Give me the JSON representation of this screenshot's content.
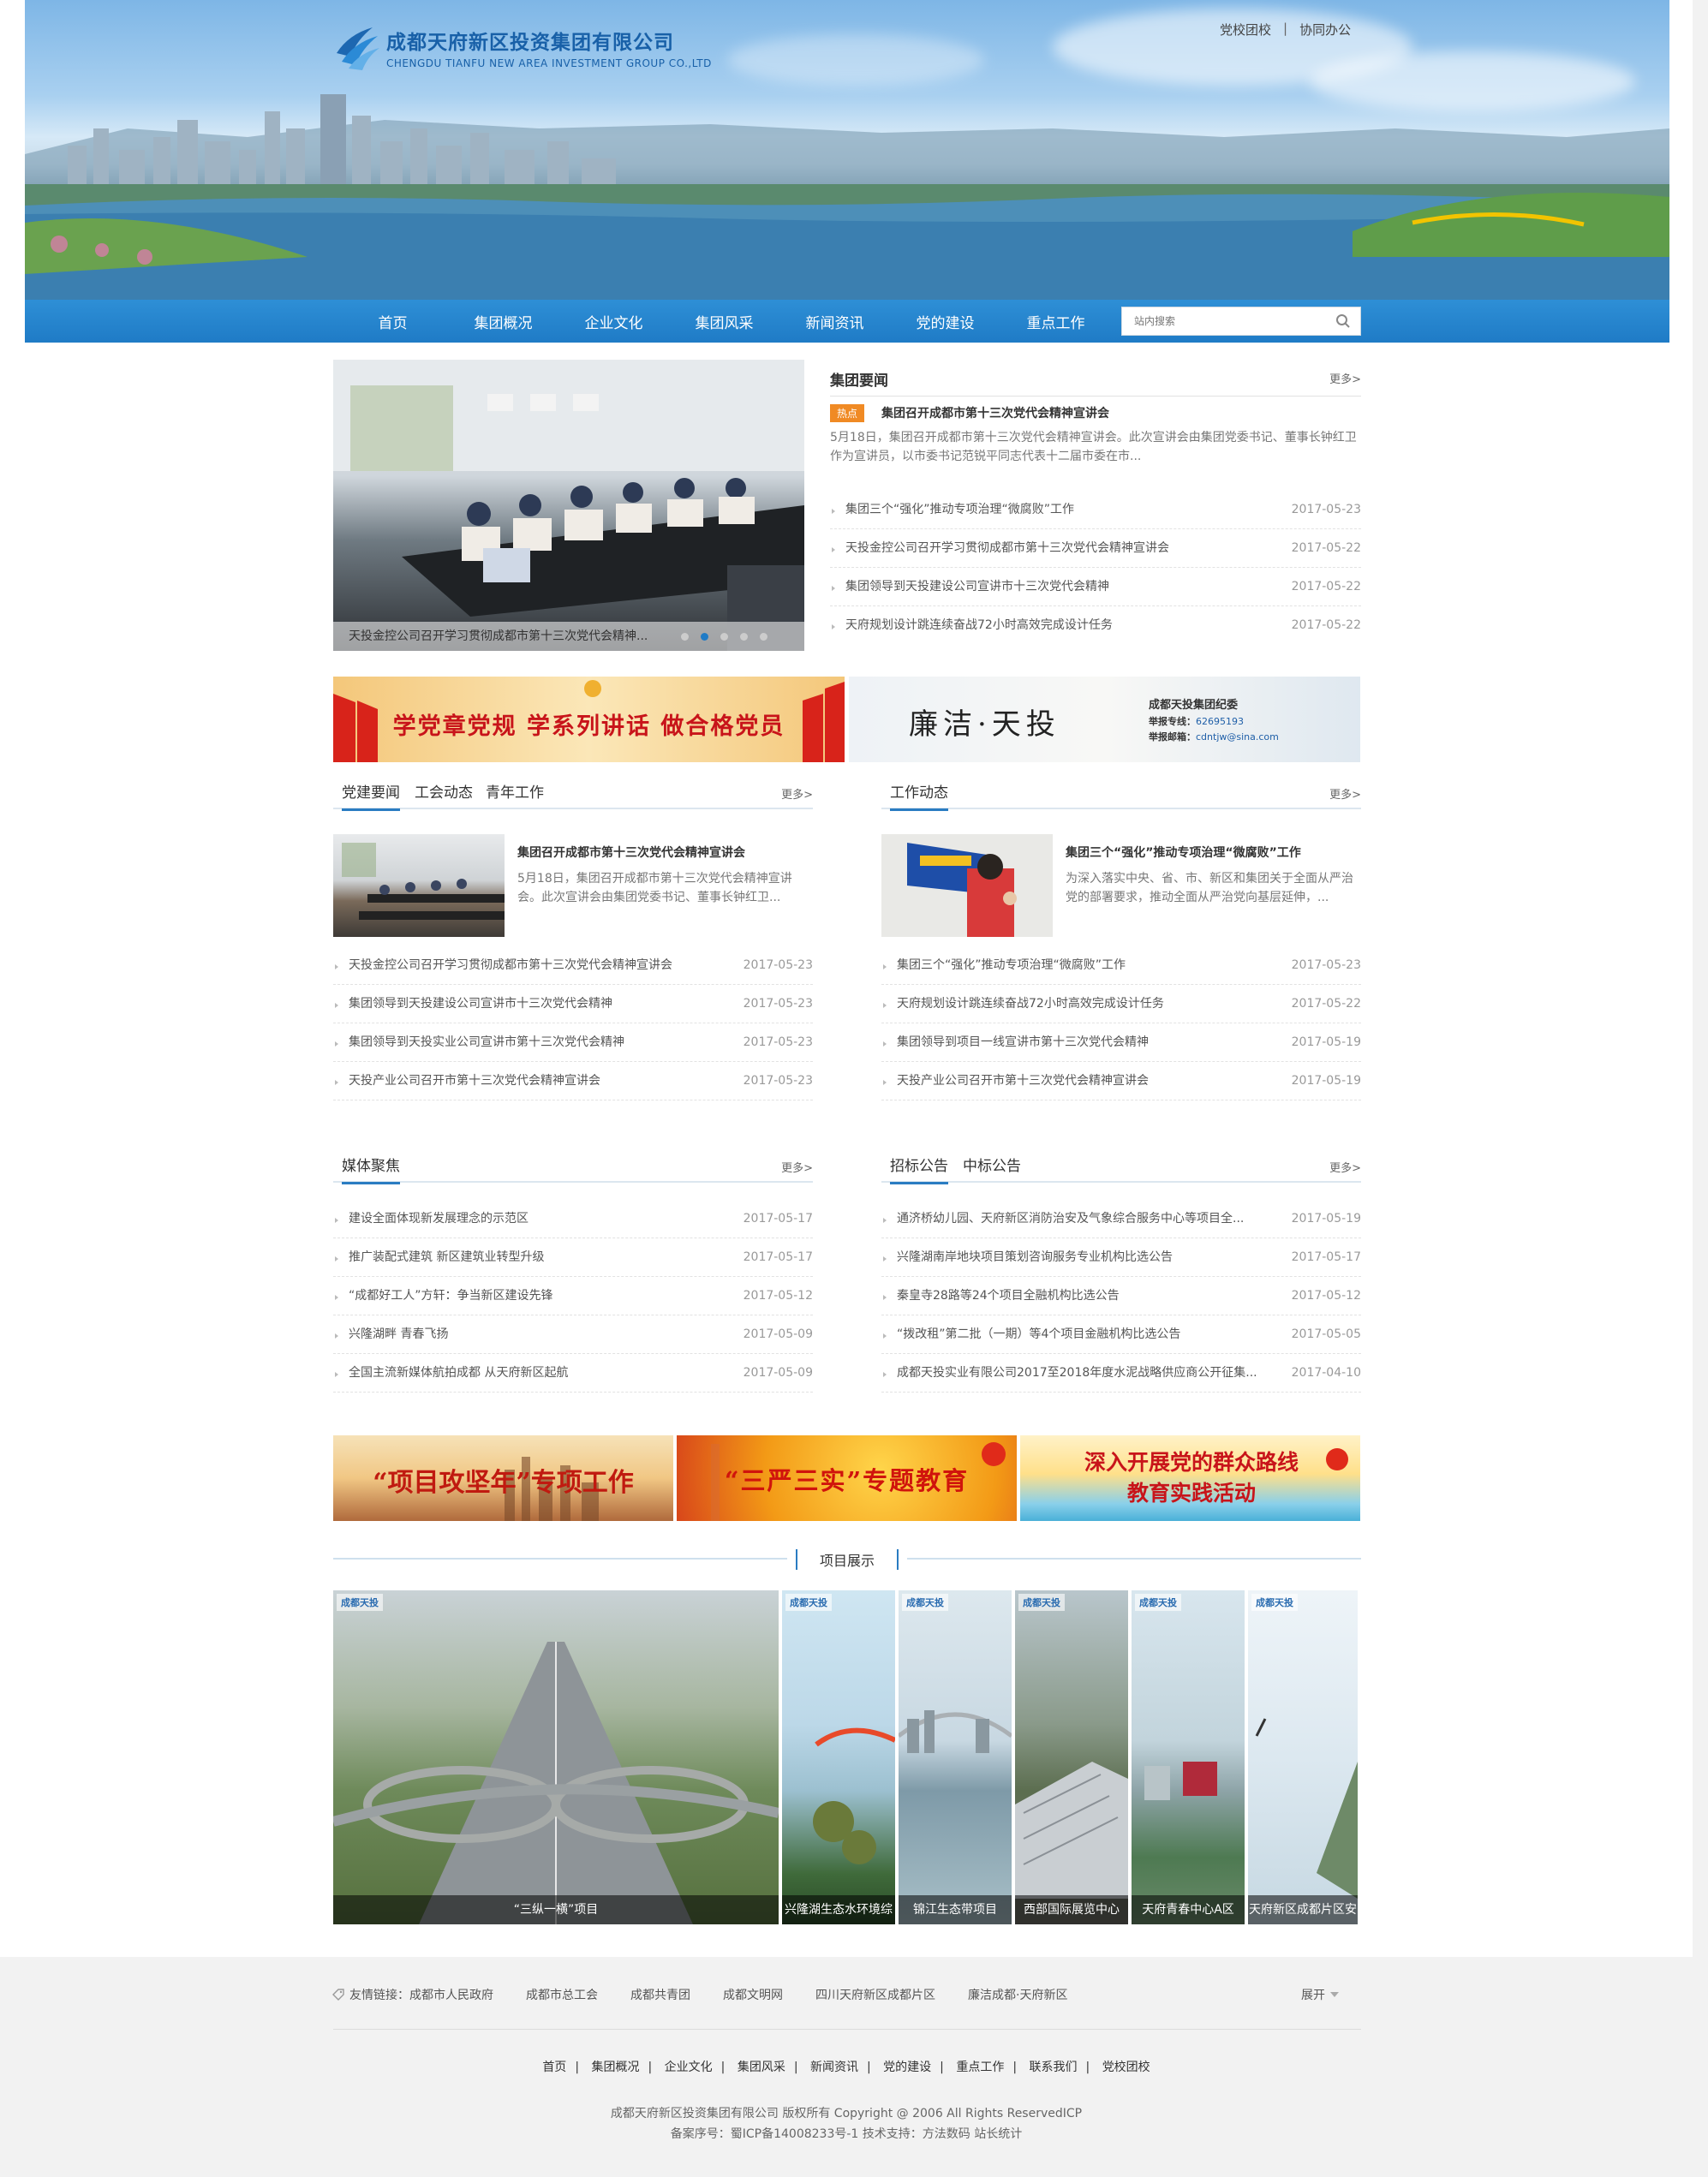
{
  "header": {
    "company_cn": "成都天府新区投资集团有限公司",
    "company_en": "CHENGDU TIANFU NEW AREA INVESTMENT GROUP CO.,LTD",
    "top_links": [
      "党校团校",
      "协同办公"
    ],
    "top_sep": "|"
  },
  "nav": {
    "items": [
      "首页",
      "集团概况",
      "企业文化",
      "集团风采",
      "新闻资讯",
      "党的建设",
      "重点工作"
    ],
    "search_placeholder": "站内搜索"
  },
  "slider": {
    "caption": "天投金控公司召开学习贯彻成都市第十三次党代会精神...",
    "dots": 5,
    "active_dot": 2
  },
  "group_news": {
    "title": "集团要闻",
    "more": "更多>",
    "hot_badge": "热点",
    "headline": "集团召开成都市第十三次党代会精神宣讲会",
    "summary": "5月18日，集团召开成都市第十三次党代会精神宣讲会。此次宣讲会由集团党委书记、董事长钟红卫作为宣讲员，以市委书记范锐平同志代表十二届市委在市...",
    "items": [
      {
        "title": "集团三个“强化”推动专项治理“微腐败”工作",
        "date": "2017-05-23"
      },
      {
        "title": "天投金控公司召开学习贯彻成都市第十三次党代会精神宣讲会",
        "date": "2017-05-22"
      },
      {
        "title": "集团领导到天投建设公司宣讲市十三次党代会精神",
        "date": "2017-05-22"
      },
      {
        "title": "天府规划设计跳连续奋战72小时高效完成设计任务",
        "date": "2017-05-22"
      }
    ]
  },
  "banners_top": {
    "left": "学党章党规 学系列讲话 做合格党员",
    "right_title": "廉洁·天投",
    "right_org": "成都天投集团纪委",
    "right_phone_label": "举报专线：",
    "right_phone": "62695193",
    "right_mail_label": "举报邮箱：",
    "right_mail": "cdntjw@sina.com"
  },
  "party": {
    "tabs": [
      "党建要闻",
      "工会动态",
      "青年工作"
    ],
    "more": "更多>",
    "feature_title": "集团召开成都市第十三次党代会精神宣讲会",
    "feature_summary": "5月18日，集团召开成都市第十三次党代会精神宣讲会。此次宣讲会由集团党委书记、董事长钟红卫...",
    "items": [
      {
        "title": "天投金控公司召开学习贯彻成都市第十三次党代会精神宣讲会",
        "date": "2017-05-23"
      },
      {
        "title": "集团领导到天投建设公司宣讲市十三次党代会精神",
        "date": "2017-05-23"
      },
      {
        "title": "集团领导到天投实业公司宣讲市第十三次党代会精神",
        "date": "2017-05-23"
      },
      {
        "title": "天投产业公司召开市第十三次党代会精神宣讲会",
        "date": "2017-05-23"
      }
    ]
  },
  "work": {
    "tabs": [
      "工作动态"
    ],
    "more": "更多>",
    "feature_title": "集团三个“强化”推动专项治理“微腐败”工作",
    "feature_summary": "为深入落实中央、省、市、新区和集团关于全面从严治党的部署要求，推动全面从严治党向基层延伸，...",
    "items": [
      {
        "title": "集团三个“强化”推动专项治理“微腐败”工作",
        "date": "2017-05-23"
      },
      {
        "title": "天府规划设计跳连续奋战72小时高效完成设计任务",
        "date": "2017-05-22"
      },
      {
        "title": "集团领导到项目一线宣讲市第十三次党代会精神",
        "date": "2017-05-19"
      },
      {
        "title": "天投产业公司召开市第十三次党代会精神宣讲会",
        "date": "2017-05-19"
      }
    ]
  },
  "media": {
    "tabs": [
      "媒体聚焦"
    ],
    "more": "更多>",
    "items": [
      {
        "title": "建设全面体现新发展理念的示范区",
        "date": "2017-05-17"
      },
      {
        "title": "推广装配式建筑 新区建筑业转型升级",
        "date": "2017-05-17"
      },
      {
        "title": "“成都好工人”方轩：争当新区建设先锋",
        "date": "2017-05-12"
      },
      {
        "title": "兴隆湖畔 青春飞扬",
        "date": "2017-05-09"
      },
      {
        "title": "全国主流新媒体航拍成都 从天府新区起航",
        "date": "2017-05-09"
      }
    ]
  },
  "tender": {
    "tabs": [
      "招标公告",
      "中标公告"
    ],
    "more": "更多>",
    "items": [
      {
        "title": "通济桥幼儿园、天府新区消防治安及气象综合服务中心等项目全...",
        "date": "2017-05-19"
      },
      {
        "title": "兴隆湖南岸地块项目策划咨询服务专业机构比选公告",
        "date": "2017-05-17"
      },
      {
        "title": "秦皇寺28路等24个项目全融机构比选公告",
        "date": "2017-05-12"
      },
      {
        "title": "“拨改租”第二批（一期）等4个项目金融机构比选公告",
        "date": "2017-05-05"
      },
      {
        "title": "成都天投实业有限公司2017至2018年度水泥战略供应商公开征集...",
        "date": "2017-04-10"
      }
    ]
  },
  "banners_mid": [
    "“项目攻坚年”专项工作",
    "“三严三实”专题教育",
    "深入开展党的群众路线教育实践活动"
  ],
  "projects": {
    "title": "项目展示",
    "logo": "成都天投",
    "items": [
      "“三纵一横”项目",
      "兴隆湖生态水环境综",
      "锦江生态带项目",
      "西部国际展览中心",
      "天府青春中心A区",
      "天府新区成都片区安"
    ]
  },
  "footer": {
    "links_label": "友情链接：",
    "links": [
      "成都市人民政府",
      "成都市总工会",
      "成都共青团",
      "成都文明网",
      "四川天府新区成都片区",
      "廉洁成都·天府新区"
    ],
    "expand": "展开",
    "nav": [
      "首页",
      "集团概况",
      "企业文化",
      "集团风采",
      "新闻资讯",
      "党的建设",
      "重点工作",
      "联系我们",
      "党校团校"
    ],
    "copyright": "成都天府新区投资集团有限公司 版权所有 Copyright @ 2006 All Rights ReservedICP",
    "icp": "备案序号：蜀ICP备14008233号-1 技术支持：方法数码 站长统计"
  },
  "colors": {
    "brand_blue": "#1f7bc6",
    "hot_orange": "#f08a24",
    "footer_bg": "#f2f2f2"
  }
}
